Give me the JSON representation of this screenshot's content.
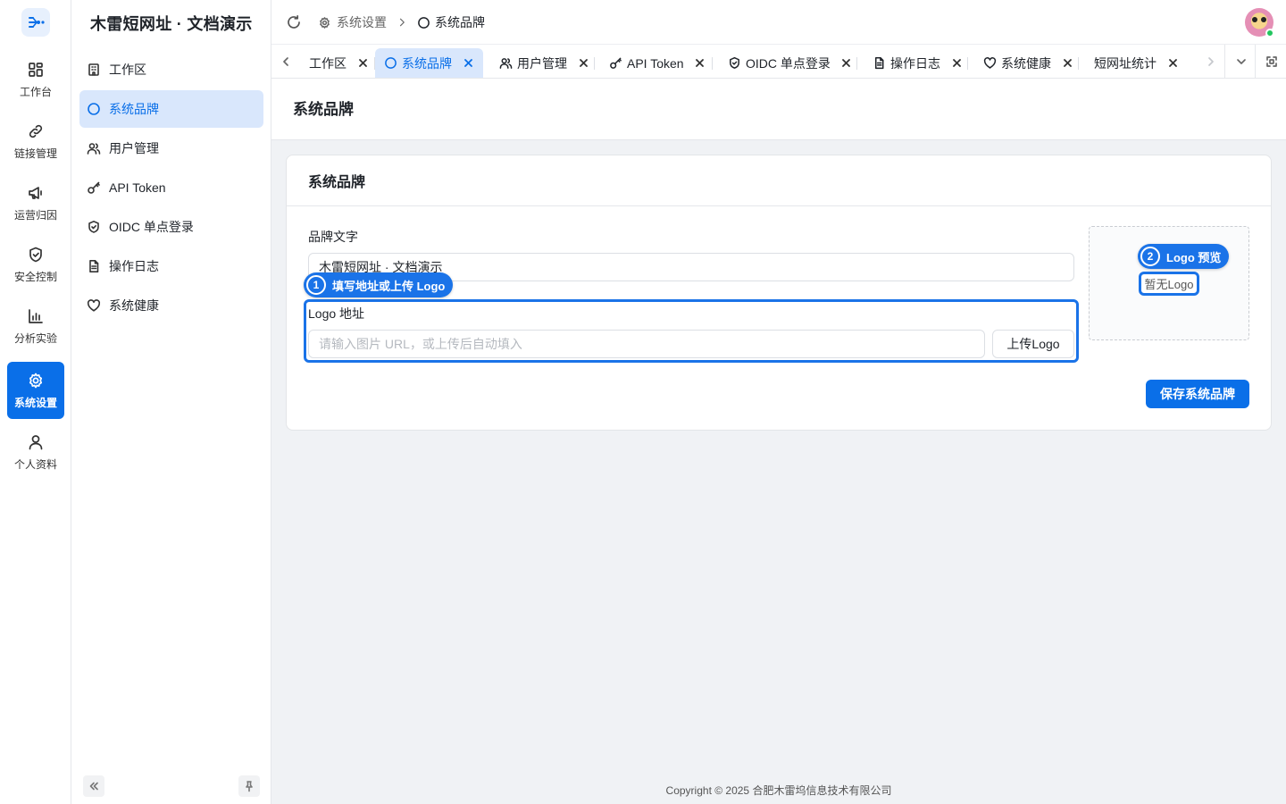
{
  "app": {
    "title": "木雷短网址 · 文档演示"
  },
  "rail": {
    "items": [
      {
        "label": "工作台",
        "icon": "dashboard-grid-icon"
      },
      {
        "label": "链接管理",
        "icon": "link-icon"
      },
      {
        "label": "运营归因",
        "icon": "megaphone-icon"
      },
      {
        "label": "安全控制",
        "icon": "shield-check-icon"
      },
      {
        "label": "分析实验",
        "icon": "bar-chart-icon"
      },
      {
        "label": "系统设置",
        "icon": "gear-icon",
        "active": true
      },
      {
        "label": "个人资料",
        "icon": "user-icon"
      }
    ]
  },
  "menu": {
    "items": [
      {
        "label": "工作区",
        "icon": "building-icon"
      },
      {
        "label": "系统品牌",
        "icon": "circle-icon",
        "active": true
      },
      {
        "label": "用户管理",
        "icon": "users-icon"
      },
      {
        "label": "API Token",
        "icon": "key-icon"
      },
      {
        "label": "OIDC 单点登录",
        "icon": "shield-check-icon"
      },
      {
        "label": "操作日志",
        "icon": "document-icon"
      },
      {
        "label": "系统健康",
        "icon": "heart-icon"
      }
    ]
  },
  "breadcrumb": {
    "parent": "系统设置",
    "current": "系统品牌"
  },
  "tabs": [
    {
      "label": "工作区",
      "icon": "building-icon"
    },
    {
      "label": "系统品牌",
      "icon": "circle-icon",
      "active": true
    },
    {
      "label": "用户管理",
      "icon": "users-icon"
    },
    {
      "label": "API Token",
      "icon": "key-icon"
    },
    {
      "label": "OIDC 单点登录",
      "icon": "shield-check-icon"
    },
    {
      "label": "操作日志",
      "icon": "document-icon"
    },
    {
      "label": "系统健康",
      "icon": "heart-icon"
    },
    {
      "label": "短网址统计",
      "icon": ""
    }
  ],
  "page": {
    "title": "系统品牌",
    "card_title": "系统品牌"
  },
  "form": {
    "brand_label": "品牌文字",
    "brand_value": "木雷短网址 · 文档演示",
    "logo_label": "Logo 地址",
    "logo_placeholder": "请输入图片 URL，或上传后自动填入",
    "upload_label": "上传Logo",
    "preview_empty": "暂无Logo",
    "save_label": "保存系统品牌"
  },
  "callouts": [
    {
      "num": "1",
      "text": "填写地址或上传 Logo"
    },
    {
      "num": "2",
      "text": "Logo 预览"
    }
  ],
  "accent_color": "#0a6fe8",
  "footer": "Copyright © 2025 合肥木雷坞信息技术有限公司"
}
